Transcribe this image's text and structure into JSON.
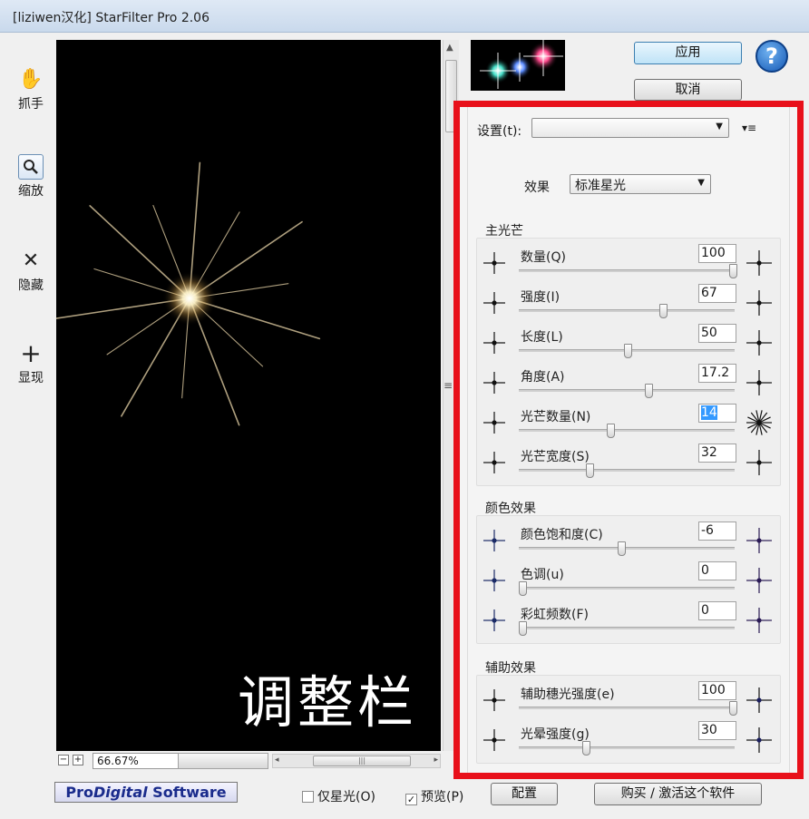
{
  "window": {
    "title": "[liziwen汉化] StarFilter Pro 2.06"
  },
  "tools": [
    {
      "label": "抓手",
      "icon": "hand-icon"
    },
    {
      "label": "缩放",
      "icon": "zoom-icon"
    },
    {
      "label": "隐藏",
      "icon": "hide-x-icon"
    },
    {
      "label": "显现",
      "icon": "show-plus-icon"
    }
  ],
  "preview": {
    "overlay_text": "调整栏"
  },
  "zoom": {
    "minus": "−",
    "plus": "+",
    "value": "66.67%"
  },
  "buttons": {
    "apply": "应用",
    "cancel": "取消",
    "help": "?"
  },
  "settings": {
    "label": "设置(t):",
    "value": "",
    "menu_glyph": "▾≡"
  },
  "effect": {
    "label": "效果",
    "value": "标准星光"
  },
  "groups": {
    "main": {
      "title": "主光芒",
      "rows": [
        {
          "label": "数量(Q)",
          "value": "100",
          "pos": 1.0
        },
        {
          "label": "强度(I)",
          "value": "67",
          "pos": 0.67
        },
        {
          "label": "长度(L)",
          "value": "50",
          "pos": 0.5
        },
        {
          "label": "角度(A)",
          "value": "17.2",
          "pos": 0.6
        },
        {
          "label": "光芒数量(N)",
          "value": "14",
          "pos": 0.42
        },
        {
          "label": "光芒宽度(S)",
          "value": "32",
          "pos": 0.32
        }
      ]
    },
    "color": {
      "title": "颜色效果",
      "rows": [
        {
          "label": "颜色饱和度(C)",
          "value": "-6",
          "pos": 0.47
        },
        {
          "label": "色调(u)",
          "value": "0",
          "pos": 0.0
        },
        {
          "label": "彩虹频数(F)",
          "value": "0",
          "pos": 0.0
        }
      ]
    },
    "aux": {
      "title": "辅助效果",
      "rows": [
        {
          "label": "辅助穗光强度(e)",
          "value": "100",
          "pos": 1.0
        },
        {
          "label": "光晕强度(g)",
          "value": "30",
          "pos": 0.3
        }
      ]
    }
  },
  "footer": {
    "logo_a": "Pro",
    "logo_b": "Digital",
    "logo_c": " Software",
    "stars_only": "仅星光(O)",
    "stars_only_checked": false,
    "preview": "预览(P)",
    "preview_checked": true,
    "config": "配置",
    "buy": "购买 / 激活这个软件"
  }
}
